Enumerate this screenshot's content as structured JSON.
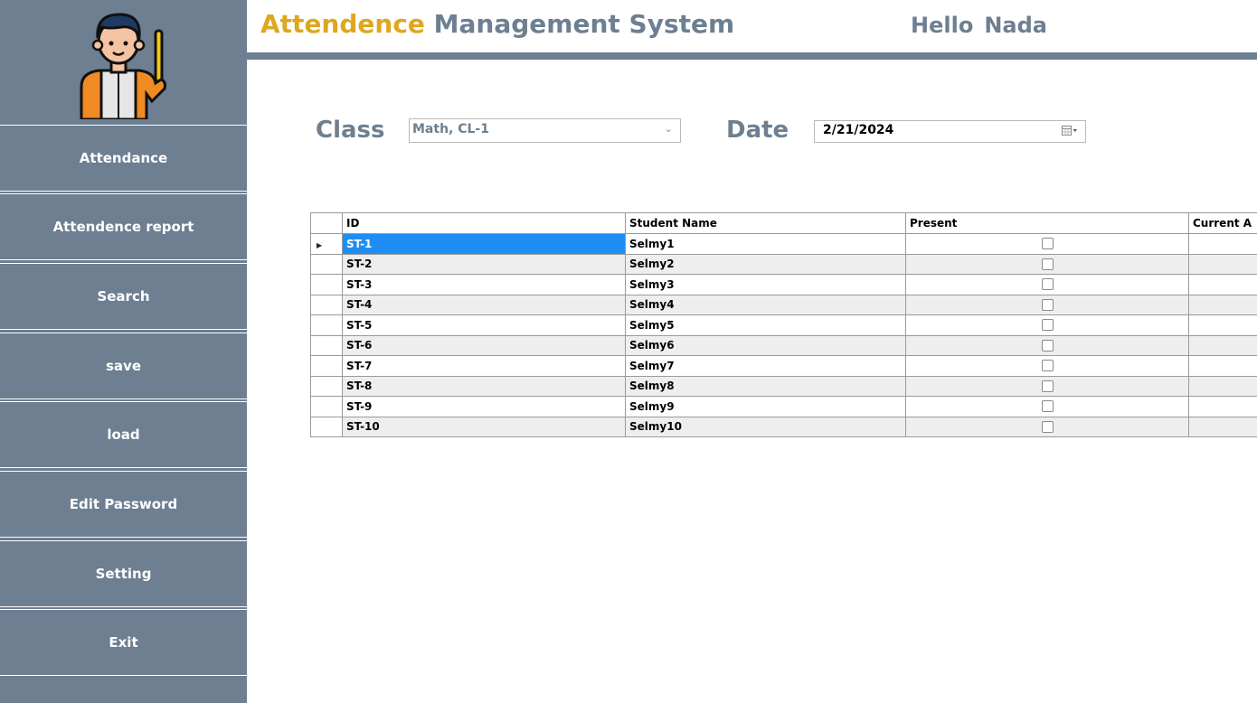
{
  "header": {
    "title_part1": "Attendence",
    "title_part2": "Management System",
    "greeting": "Hello",
    "user_name": "Nada"
  },
  "sidebar": {
    "items": [
      {
        "label": "Attendance"
      },
      {
        "label": "Attendence report"
      },
      {
        "label": "Search"
      },
      {
        "label": "save"
      },
      {
        "label": "load"
      },
      {
        "label": "Edit Password"
      },
      {
        "label": "Setting"
      },
      {
        "label": "Exit"
      }
    ]
  },
  "filters": {
    "class_label": "Class",
    "class_value": "Math, CL-1",
    "date_label": "Date",
    "date_value": "2/21/2024"
  },
  "table": {
    "columns": [
      "ID",
      "Student Name",
      "Present",
      "Current A"
    ],
    "rows": [
      {
        "id": "ST-1",
        "name": "Selmy1"
      },
      {
        "id": "ST-2",
        "name": "Selmy2"
      },
      {
        "id": "ST-3",
        "name": "Selmy3"
      },
      {
        "id": "ST-4",
        "name": "Selmy4"
      },
      {
        "id": "ST-5",
        "name": "Selmy5"
      },
      {
        "id": "ST-6",
        "name": "Selmy6"
      },
      {
        "id": "ST-7",
        "name": "Selmy7"
      },
      {
        "id": "ST-8",
        "name": "Selmy8"
      },
      {
        "id": "ST-9",
        "name": "Selmy9"
      },
      {
        "id": "ST-10",
        "name": "Selmy10"
      }
    ]
  },
  "colors": {
    "accent": "#dea71f",
    "primary": "#6d7f91",
    "selection": "#1f8ef4"
  }
}
